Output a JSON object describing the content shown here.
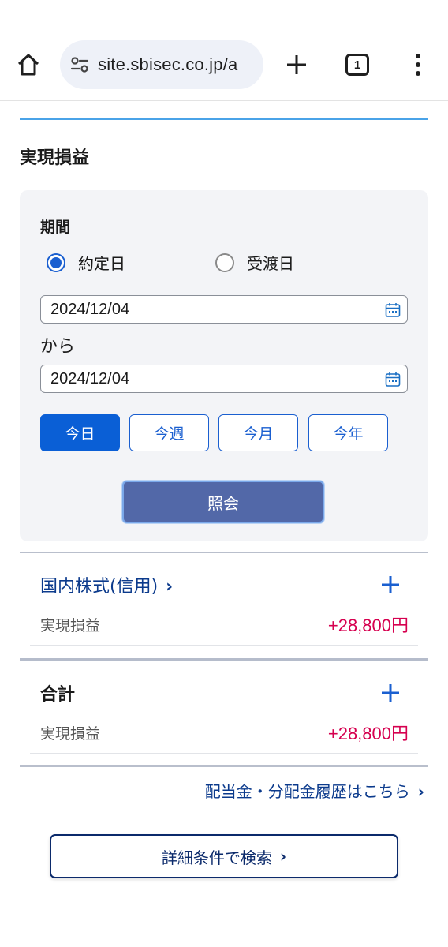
{
  "browser": {
    "url": "site.sbisec.co.jp/a",
    "tab_count": "1"
  },
  "page": {
    "section_title": "実現損益",
    "period_label": "期間",
    "radio": {
      "yakujo": "約定日",
      "ukewatashi": "受渡日",
      "selected": "約定日"
    },
    "date_from": "2024/12/04",
    "kara": "から",
    "date_to": "2024/12/04",
    "quick_buttons": [
      "今日",
      "今週",
      "今月",
      "今年"
    ],
    "quick_active": "今日",
    "inquiry_label": "照会",
    "domestic": {
      "title": "国内株式(信用)",
      "chevron": "›",
      "pnl_label": "実現損益",
      "pnl_value": "+28,800円"
    },
    "total": {
      "title": "合計",
      "pnl_label": "実現損益",
      "pnl_value": "+28,800円"
    },
    "dividend_link": "配当金・分配金履歴はこちら",
    "dividend_chevron": "›",
    "detail_search": "詳細条件で検索",
    "detail_chevron": "›"
  },
  "colors": {
    "accent": "#0a5fd6",
    "link": "#0b3a8c",
    "positive": "#d6004f",
    "top_rule": "#4aa3e8",
    "inquiry_bg": "#5268a8"
  }
}
